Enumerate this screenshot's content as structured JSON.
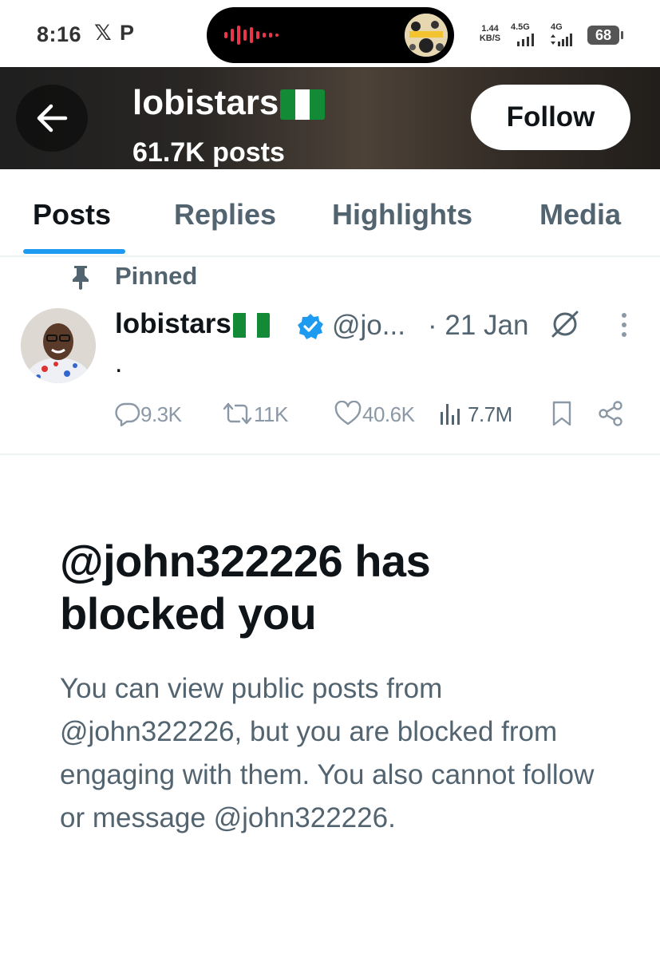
{
  "status_bar": {
    "time": "8:16",
    "x_glyph": "𝕏",
    "p_glyph": "P",
    "speed_value": "1.44",
    "speed_unit": "KB/S",
    "net1": "4.5G",
    "net2": "4G",
    "battery": "68"
  },
  "header": {
    "back_icon": "arrow-left-icon",
    "display_name": "lobistars",
    "flag_emoji": "nigeria-flag",
    "post_count": "61.7K posts",
    "follow_label": "Follow"
  },
  "tabs": [
    {
      "label": "Posts",
      "active": true
    },
    {
      "label": "Replies",
      "active": false
    },
    {
      "label": "Highlights",
      "active": false
    },
    {
      "label": "Media",
      "active": false
    }
  ],
  "pinned_post": {
    "pinned_label": "Pinned",
    "name": "lobistars",
    "handle": "@jo...",
    "date": "· 21 Jan",
    "body": ".",
    "replies": "9.3K",
    "reposts": "11K",
    "likes": "40.6K",
    "views": "7.7M"
  },
  "blocked": {
    "title": "@john322226 has blocked you",
    "description": "You can view public posts from @john322226, but you are blocked from engaging with them. You also cannot follow or message @john322226."
  },
  "colors": {
    "accent": "#1d9bf0",
    "text_primary": "#0f1419",
    "text_secondary": "#536471",
    "flag_green": "#138a36"
  }
}
